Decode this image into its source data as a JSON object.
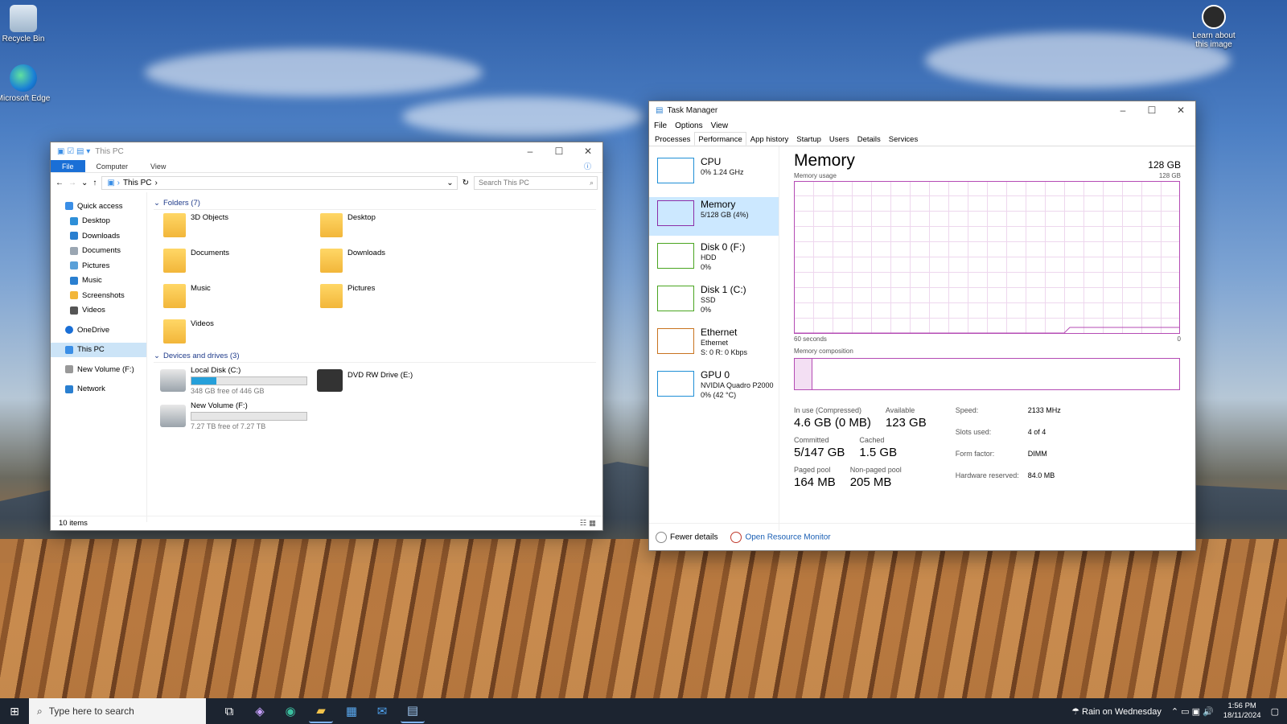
{
  "desktop": {
    "icons": [
      {
        "label": "Recycle Bin"
      },
      {
        "label": "Microsoft Edge"
      },
      {
        "label": "Learn about this image"
      }
    ]
  },
  "explorer": {
    "title": "This PC",
    "ribbon_tabs": [
      "File",
      "Computer",
      "View"
    ],
    "address": "This PC",
    "search_placeholder": "Search This PC",
    "nav": [
      "Quick access",
      "Desktop",
      "Downloads",
      "Documents",
      "Pictures",
      "Music",
      "Screenshots",
      "Videos",
      "OneDrive",
      "This PC",
      "New Volume (F:)",
      "Network"
    ],
    "folders_header": "Folders (7)",
    "folders": [
      "3D Objects",
      "Desktop",
      "Documents",
      "Downloads",
      "Music",
      "Pictures",
      "Videos"
    ],
    "drives_header": "Devices and drives (3)",
    "drives": [
      {
        "name": "Local Disk (C:)",
        "free": "348 GB free of 446 GB",
        "used_fraction": 0.22
      },
      {
        "name": "DVD RW Drive (E:)"
      },
      {
        "name": "New Volume (F:)",
        "free": "7.27 TB free of 7.27 TB",
        "used_fraction": 0.0
      }
    ],
    "status": "10 items"
  },
  "taskmgr": {
    "title": "Task Manager",
    "menu": [
      "File",
      "Options",
      "View"
    ],
    "tabs": [
      "Processes",
      "Performance",
      "App history",
      "Startup",
      "Users",
      "Details",
      "Services"
    ],
    "sidebar": [
      {
        "name": "CPU",
        "l1": "0% 1.24 GHz",
        "l2": "",
        "color": "#1f8fd6"
      },
      {
        "name": "Memory",
        "l1": "5/128 GB (4%)",
        "l2": "",
        "color": "#8b2ea8"
      },
      {
        "name": "Disk 0 (F:)",
        "l1": "HDD",
        "l2": "0%",
        "color": "#4aa520"
      },
      {
        "name": "Disk 1 (C:)",
        "l1": "SSD",
        "l2": "0%",
        "color": "#4aa520"
      },
      {
        "name": "Ethernet",
        "l1": "Ethernet",
        "l2": "S: 0  R: 0 Kbps",
        "color": "#c8731f"
      },
      {
        "name": "GPU 0",
        "l1": "NVIDIA Quadro P2000",
        "l2": "0% (42 °C)",
        "color": "#1f8fd6"
      }
    ],
    "main": {
      "title": "Memory",
      "capacity": "128 GB",
      "usage_label": "Memory usage",
      "usage_max": "128 GB",
      "time_label": "60 seconds",
      "time_min": "0",
      "composition_label": "Memory composition",
      "stats": [
        {
          "k": "In use (Compressed)",
          "v": "4.6 GB (0 MB)"
        },
        {
          "k": "Available",
          "v": "123 GB"
        },
        {
          "k": "Committed",
          "v": "5/147 GB"
        },
        {
          "k": "Cached",
          "v": "1.5 GB"
        },
        {
          "k": "Paged pool",
          "v": "164 MB"
        },
        {
          "k": "Non-paged pool",
          "v": "205 MB"
        }
      ],
      "specs": [
        {
          "k": "Speed:",
          "v": "2133 MHz"
        },
        {
          "k": "Slots used:",
          "v": "4 of 4"
        },
        {
          "k": "Form factor:",
          "v": "DIMM"
        },
        {
          "k": "Hardware reserved:",
          "v": "84.0 MB"
        }
      ]
    },
    "footer": {
      "fewer": "Fewer details",
      "resmon": "Open Resource Monitor"
    }
  },
  "taskbar": {
    "search_placeholder": "Type here to search",
    "weather": "Rain on Wednesday",
    "time": "1:56 PM",
    "date": "18/11/2024"
  }
}
